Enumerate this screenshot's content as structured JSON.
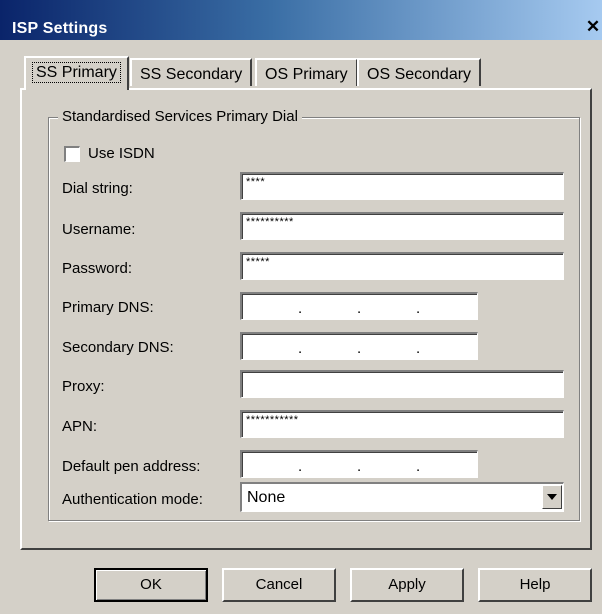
{
  "window": {
    "title": "ISP Settings",
    "close_glyph": "✕"
  },
  "tabs": [
    {
      "label": "SS Primary",
      "active": true
    },
    {
      "label": "SS Secondary",
      "active": false
    },
    {
      "label": "OS Primary",
      "active": false
    },
    {
      "label": "OS Secondary",
      "active": false
    }
  ],
  "group": {
    "title": "Standardised Services Primary Dial",
    "use_isdn_label": "Use ISDN",
    "use_isdn_checked": false
  },
  "fields": {
    "dial_string": {
      "label": "Dial string:",
      "value": "****"
    },
    "username": {
      "label": "Username:",
      "value": "**********"
    },
    "password": {
      "label": "Password:",
      "value": "*****"
    },
    "primary_dns": {
      "label": "Primary DNS:"
    },
    "secondary_dns": {
      "label": "Secondary DNS:"
    },
    "proxy": {
      "label": "Proxy:",
      "value": ""
    },
    "apn": {
      "label": "APN:",
      "value": "***********"
    },
    "default_pen": {
      "label": "Default pen address:"
    },
    "auth_mode": {
      "label": "Authentication mode:",
      "value": "None"
    }
  },
  "ip_dot": ".",
  "buttons": {
    "ok": "OK",
    "cancel": "Cancel",
    "apply": "Apply",
    "help": "Help"
  }
}
